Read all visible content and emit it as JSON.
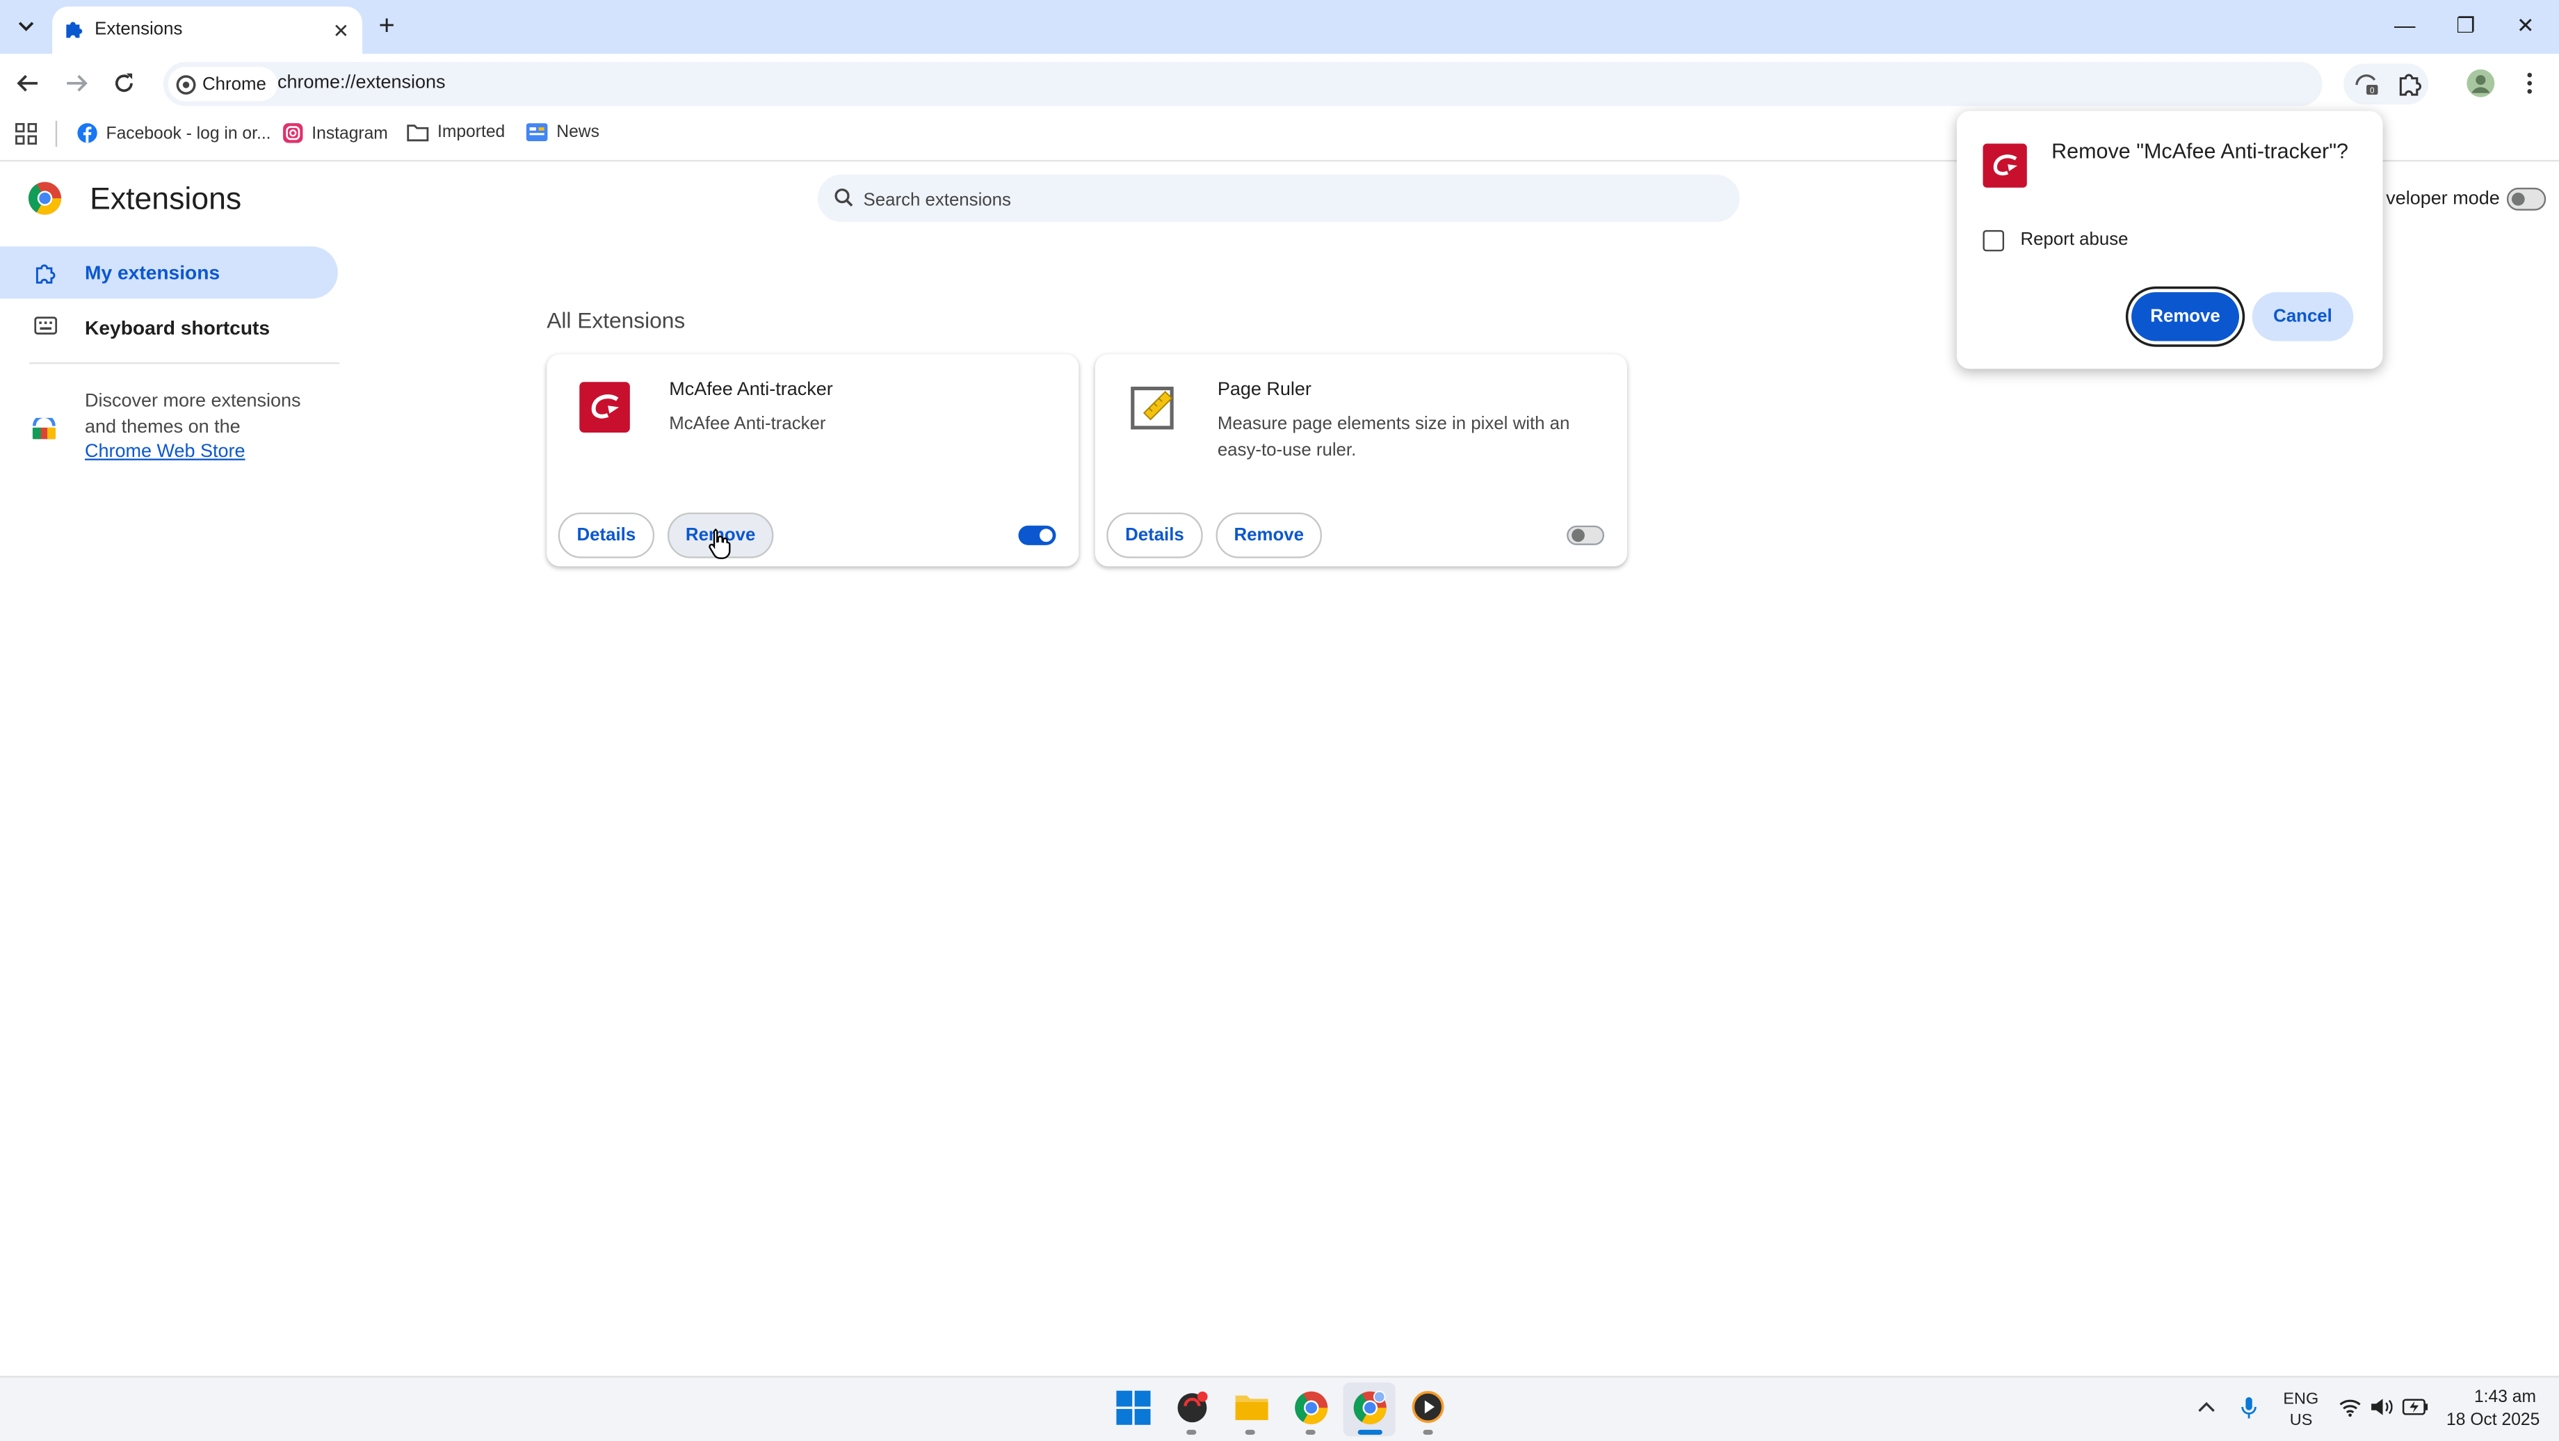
{
  "window": {
    "tab_title": "Extensions",
    "tab_close": "✕",
    "new_tab": "+",
    "minimize": "—",
    "restore": "❐",
    "close": "✕"
  },
  "toolbar": {
    "site_chip": "Chrome",
    "url": "chrome://extensions"
  },
  "bookmarks": [
    {
      "label": "Facebook - log in or...",
      "icon": "facebook-icon"
    },
    {
      "label": "Instagram",
      "icon": "instagram-icon"
    },
    {
      "label": "Imported",
      "icon": "folder-icon"
    },
    {
      "label": "News",
      "icon": "news-icon"
    }
  ],
  "page": {
    "title": "Extensions",
    "search_placeholder": "Search extensions",
    "developer_mode_label": "veloper mode",
    "section_heading": "All Extensions"
  },
  "sidebar": {
    "items": [
      {
        "label": "My extensions",
        "selected": true
      },
      {
        "label": "Keyboard shortcuts",
        "selected": false
      }
    ],
    "discover_text": "Discover more extensions and themes on the",
    "store_link": "Chrome Web Store"
  },
  "extensions": [
    {
      "name": "McAfee Anti-tracker",
      "description": "McAfee Anti-tracker",
      "details_label": "Details",
      "remove_label": "Remove",
      "enabled": true
    },
    {
      "name": "Page Ruler",
      "description": "Measure page elements size in pixel with an easy-to-use ruler.",
      "details_label": "Details",
      "remove_label": "Remove",
      "enabled": false
    }
  ],
  "dialog": {
    "title": "Remove \"McAfee Anti-tracker\"?",
    "checkbox_label": "Report abuse",
    "checkbox_checked": false,
    "confirm_label": "Remove",
    "cancel_label": "Cancel"
  },
  "taskbar": {
    "lang_top": "ENG",
    "lang_bottom": "US",
    "time": "1:43 am",
    "date": "18 Oct 2025"
  },
  "colors": {
    "accent": "#0b57d0",
    "titlebar": "#d3e3fd",
    "mcafee_red": "#c8102e"
  }
}
